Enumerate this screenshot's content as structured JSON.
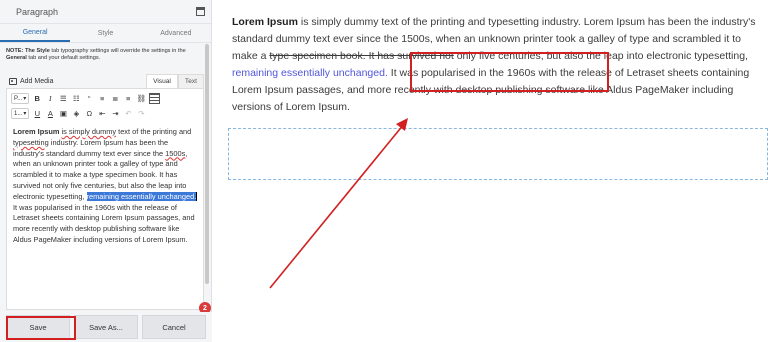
{
  "panel": {
    "title": "Paragraph",
    "tabs": [
      {
        "label": "General",
        "active": true
      },
      {
        "label": "Style",
        "active": false
      },
      {
        "label": "Advanced",
        "active": false
      }
    ],
    "note": {
      "prefix": "NOTE: The ",
      "style_word": "Style",
      "mid": " tab typography settings will override the settings in the ",
      "general_word": "General",
      "suffix": " tab and your default settings."
    },
    "add_media": "Add Media",
    "editor_tabs": [
      {
        "label": "Visual",
        "active": true
      },
      {
        "label": "Text",
        "active": false
      }
    ],
    "toolbar": {
      "format_select": "P...",
      "size_select": "1...",
      "bold": "B",
      "italic": "I",
      "ul": "☰",
      "ol": "☷",
      "quote": "“",
      "align_left": "≡",
      "align_center": "≣",
      "align_right": "≡",
      "link": "⛓",
      "underline": "U",
      "color": "A",
      "paste": "▣",
      "clear": "◈",
      "omega": "Ω",
      "indent_out": "⇤",
      "indent_in": "⇥",
      "undo": "↶",
      "redo": "↷"
    },
    "content": {
      "bold_lead": "Lorem Ipsum",
      "seg1": " ",
      "spell1": "is simply dummy",
      "seg2": " text of the printing and ",
      "spell2": "typesetting",
      "seg3": " industry. Lorem Ipsum has been the industry's standard dummy text ever since the ",
      "spell3": "1500s",
      "seg4": ", when an unknown printer took a galley of type and scrambled it to make a type specimen book. It has survived not only five centuries, but also the leap into electronic typesetting, ",
      "selected": "remaining essentially unchanged.",
      "seg5": " It was popularised in the 1960s with the release of Letraset sheets containing Lorem Ipsum passages, and more recently with desktop publishing software like Aldus PageMaker including versions of Lorem Ipsum."
    },
    "badge": "2",
    "buttons": {
      "save": "Save",
      "save_as": "Save As...",
      "cancel": "Cancel"
    }
  },
  "preview": {
    "bold_lead": "Lorem Ipsum",
    "seg1": " is simply dummy text of the printing and typesetting industry. Lorem Ipsum has been the industry's standard dummy text ever since the 1500s, when an unknown printer took a galley of type and scrambled it to make a ",
    "strike": "type specimen book. It has survived not",
    "seg2": " only five centuries, but also the leap into electronic typesetting, ",
    "highlight": "remaining essentially unchanged.",
    "seg3": " It was popularised in the 1960s with the release of Letraset sheets containing Lorem Ipsum passages, and more recently with desktop publishing software like Aldus PageMaker including versions of Lorem Ipsum."
  },
  "colors": {
    "annotation_red": "#d21f1f",
    "link_blue": "#4f56d8",
    "selection_blue": "#3c78d8",
    "tab_active": "#2b6cb0"
  }
}
